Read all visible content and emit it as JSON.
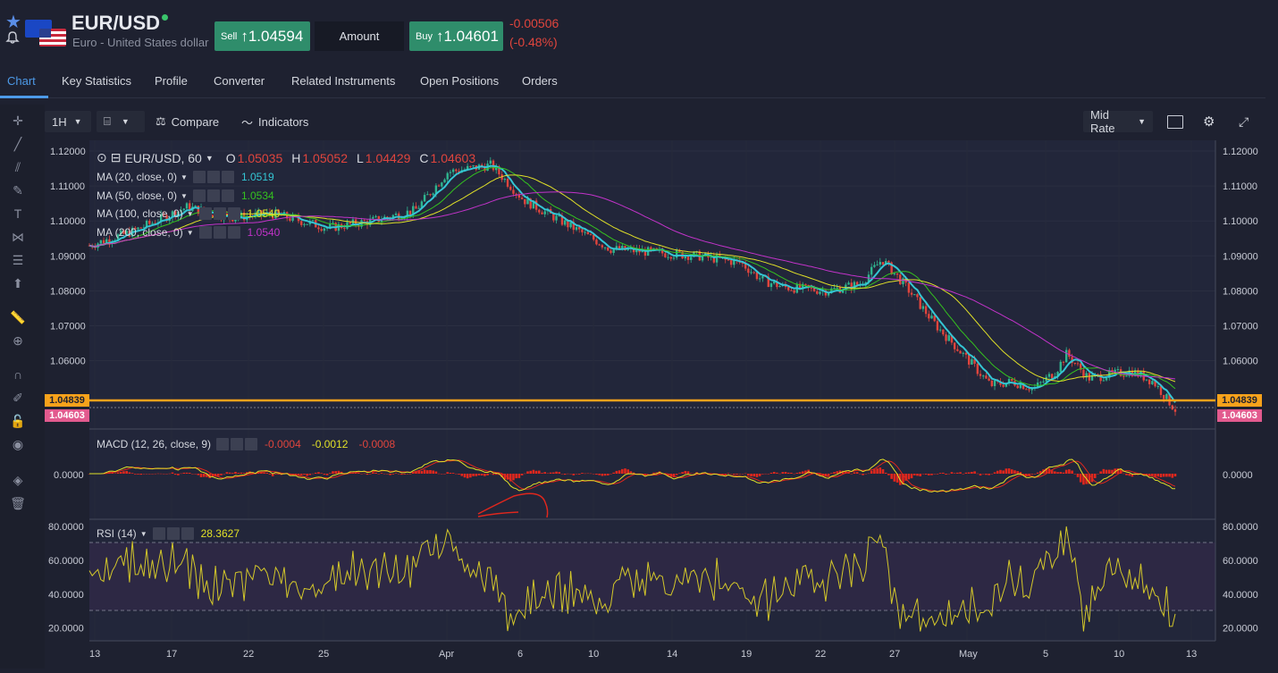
{
  "header": {
    "symbol": "EUR/USD",
    "description": "Euro - United States dollar",
    "sell_label": "Sell",
    "sell_arrow": "↑",
    "sell_price": "1.04594",
    "amount_label": "Amount",
    "buy_label": "Buy",
    "buy_arrow": "↑",
    "buy_price": "1.04601",
    "change_abs": "-0.00506",
    "change_pct": "(-0.48%)"
  },
  "tabs": [
    {
      "label": "Chart",
      "active": true
    },
    {
      "label": "Key Statistics"
    },
    {
      "label": "Profile"
    },
    {
      "label": "Converter"
    },
    {
      "label": "Related Instruments"
    },
    {
      "label": "Open Positions"
    },
    {
      "label": "Orders"
    }
  ],
  "toolbar": {
    "interval": "1H",
    "compare": "Compare",
    "indicators": "Indicators",
    "rate_mode": "Mid Rate"
  },
  "legend": {
    "title": "EUR/USD, 60",
    "o_label": "O",
    "o_value": "1.05035",
    "h_label": "H",
    "h_value": "1.05052",
    "l_label": "L",
    "l_value": "1.04429",
    "c_label": "C",
    "c_value": "1.04603",
    "ma": [
      {
        "label": "MA (20, close, 0)",
        "value": "1.0519",
        "color": "#34c6d4"
      },
      {
        "label": "MA (50, close, 0)",
        "value": "1.0534",
        "color": "#35c21f"
      },
      {
        "label": "MA (100, close, 0)",
        "value": "1.0540",
        "color": "#e0e028"
      },
      {
        "label": "MA (200, close, 0)",
        "value": "1.0540",
        "color": "#c233c9"
      }
    ]
  },
  "macd": {
    "label": "MACD (12, 26, close, 9)",
    "hist": "-0.0004",
    "macd": "-0.0012",
    "signal": "-0.0008",
    "zero_label": "0.0000"
  },
  "rsi": {
    "label": "RSI (14)",
    "value": "28.3627",
    "ticks": [
      "80.0000",
      "60.0000",
      "40.0000",
      "20.0000"
    ]
  },
  "price_axis": [
    "1.12000",
    "1.11000",
    "1.10000",
    "1.09000",
    "1.08000",
    "1.07000",
    "1.06000"
  ],
  "price_tags": {
    "orange": "1.04839",
    "pink": "1.04603"
  },
  "x_axis": [
    "13",
    "17",
    "22",
    "25",
    "Apr",
    "6",
    "10",
    "14",
    "19",
    "22",
    "27",
    "May",
    "5",
    "10",
    "13"
  ],
  "colors": {
    "up": "#2fb58f",
    "down": "#e0453d",
    "accent": "#4d9ae8",
    "orange": "#f7a21b",
    "pink": "#e25a8e"
  }
}
